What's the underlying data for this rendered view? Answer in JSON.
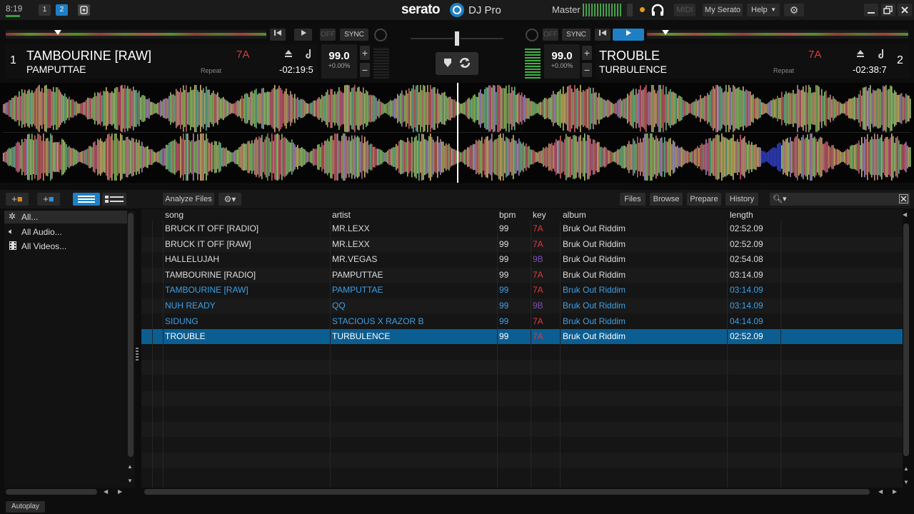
{
  "clock": "8:19",
  "layout_buttons": [
    "1",
    "2"
  ],
  "brand": {
    "logo": "serato",
    "product": "DJ Pro"
  },
  "master_label": "Master",
  "top_buttons": {
    "midi": "MIDI",
    "my_serato": "My Serato",
    "help": "Help"
  },
  "deck1": {
    "number": "1",
    "title": "TAMBOURINE [RAW]",
    "artist": "PAMPUTTAE",
    "key": "7A",
    "repeat": "Repeat",
    "time": "-02:19:5",
    "bpm": "99.0",
    "pitch": "+0.00%",
    "off_label": "OFF",
    "sync_label": "SYNC",
    "progress": 0.2
  },
  "deck2": {
    "number": "2",
    "title": "TROUBLE",
    "artist": "TURBULENCE",
    "key": "7A",
    "repeat": "Repeat",
    "time": "-02:38:7",
    "bpm": "99.0",
    "pitch": "+0.00%",
    "off_label": "OFF",
    "sync_label": "SYNC",
    "progress": 0.07
  },
  "library": {
    "analyze_label": "Analyze Files",
    "tabs": [
      "Files",
      "Browse",
      "Prepare",
      "History"
    ],
    "search_placeholder": "",
    "crates": [
      "All...",
      "All Audio...",
      "All Videos..."
    ],
    "columns": {
      "song": "song",
      "artist": "artist",
      "bpm": "bpm",
      "key": "key",
      "album": "album",
      "length": "length"
    },
    "tracks": [
      {
        "song": "BRUCK IT OFF [RADIO]",
        "artist": "MR.LEXX",
        "bpm": "99",
        "key": "7A",
        "album": "Bruk Out Riddim",
        "length": "02:52.09",
        "state": "normal"
      },
      {
        "song": "BRUCK IT OFF [RAW]",
        "artist": "MR.LEXX",
        "bpm": "99",
        "key": "7A",
        "album": "Bruk Out Riddim",
        "length": "02:52.09",
        "state": "normal"
      },
      {
        "song": "HALLELUJAH",
        "artist": "MR.VEGAS",
        "bpm": "99",
        "key": "9B",
        "album": "Bruk Out Riddim",
        "length": "02:54.08",
        "state": "normal"
      },
      {
        "song": "TAMBOURINE [RADIO]",
        "artist": "PAMPUTTAE",
        "bpm": "99",
        "key": "7A",
        "album": "Bruk Out Riddim",
        "length": "03:14.09",
        "state": "normal"
      },
      {
        "song": "TAMBOURINE [RAW]",
        "artist": "PAMPUTTAE",
        "bpm": "99",
        "key": "7A",
        "album": "Bruk Out Riddim",
        "length": "03:14.09",
        "state": "blue"
      },
      {
        "song": "NUH READY",
        "artist": "QQ",
        "bpm": "99",
        "key": "9B",
        "album": "Bruk Out Riddim",
        "length": "03:14.09",
        "state": "blue"
      },
      {
        "song": "SIDUNG",
        "artist": "STACIOUS X RAZOR B",
        "bpm": "99",
        "key": "7A",
        "album": "Bruk Out Riddim",
        "length": "04:14.09",
        "state": "blue"
      },
      {
        "song": "TROUBLE",
        "artist": "TURBULENCE",
        "bpm": "99",
        "key": "7A",
        "album": "Bruk Out Riddim",
        "length": "02:52.09",
        "state": "selected"
      }
    ]
  },
  "autoplay_label": "Autoplay",
  "colors": {
    "accent": "#1e7fc4",
    "key_red": "#e23a3a",
    "key_purple": "#7a4fb8",
    "loaded_blue": "#3ea0e6",
    "selected_row": "#0b5e92"
  }
}
